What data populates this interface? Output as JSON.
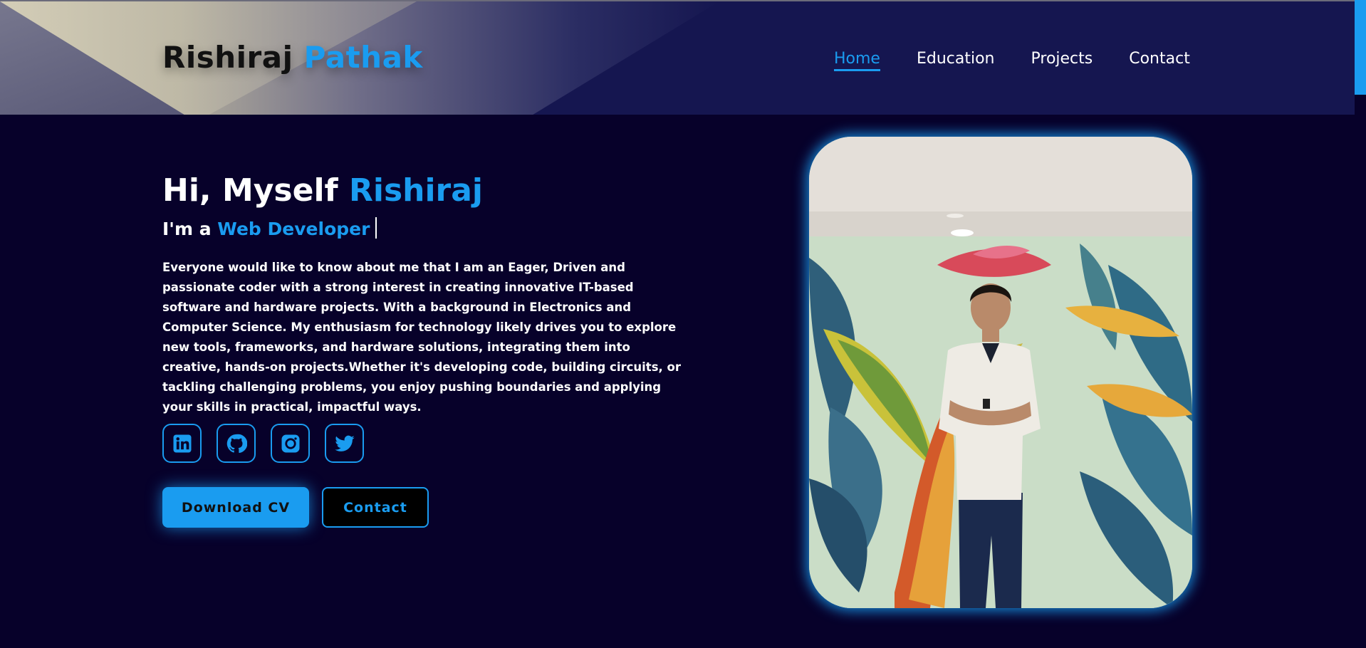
{
  "header": {
    "logo": {
      "first": "Rishiraj",
      "last": "Pathak"
    },
    "nav": [
      {
        "label": "Home",
        "active": true
      },
      {
        "label": "Education",
        "active": false
      },
      {
        "label": "Projects",
        "active": false
      },
      {
        "label": "Contact",
        "active": false
      }
    ]
  },
  "hero": {
    "greeting": "Hi, Myself ",
    "name": "Rishiraj",
    "role_prefix": "I'm a ",
    "role": "Web Developer",
    "bio": "Everyone would like to know about me that I am an Eager, Driven and passionate coder with a strong interest in creating innovative IT-based software and hardware projects. With a background in Electronics and Computer Science. My enthusiasm for technology likely drives you to explore new tools, frameworks, and hardware solutions, integrating them into creative, hands-on projects.Whether it's developing code, building circuits, or tackling challenging problems, you enjoy pushing boundaries and applying your skills in practical, impactful ways.",
    "socials": [
      {
        "icon": "linkedin-icon"
      },
      {
        "icon": "github-icon"
      },
      {
        "icon": "instagram-icon"
      },
      {
        "icon": "twitter-icon"
      }
    ],
    "buttons": {
      "download_cv": "Download CV",
      "contact": "Contact"
    }
  },
  "colors": {
    "accent": "#1a9cf0",
    "background": "#07012a",
    "header": "#151650"
  }
}
